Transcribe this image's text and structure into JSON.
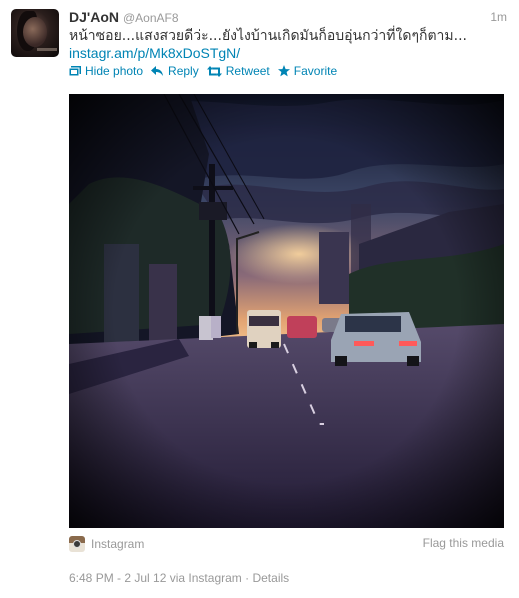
{
  "tweet": {
    "fullname": "DJ'AoN",
    "username": "@AonAF8",
    "timestamp": "1m",
    "text": "หน้าซอย...แสงสวยดีว่ะ...ยังไงบ้านเกิดมันก็อบอุ่นกว่าที่ใดๆก็ตาม...",
    "link": "instagr.am/p/Mk8xDoSTgN/"
  },
  "actions": {
    "hide_photo": "Hide photo",
    "reply": "Reply",
    "retweet": "Retweet",
    "favorite": "Favorite"
  },
  "media": {
    "provider": "Instagram",
    "flag": "Flag this media"
  },
  "footer": {
    "date": "6:48 PM - 2 Jul 12",
    "via_prefix": "via",
    "via": "Instagram",
    "separator": "·",
    "details": "Details"
  },
  "colors": {
    "link": "#0084b4",
    "muted": "#999999",
    "text": "#333333"
  },
  "icons": {
    "hide_photo": "photo-icon",
    "reply": "reply-arrow-icon",
    "retweet": "retweet-icon",
    "favorite": "star-icon",
    "provider": "instagram-icon"
  }
}
